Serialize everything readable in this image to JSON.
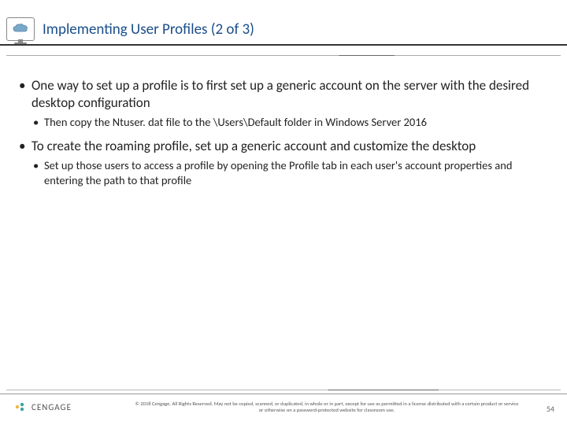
{
  "header": {
    "title": "Implementing User Profiles (2 of 3)",
    "icon": "cloud-monitor-icon"
  },
  "content": {
    "bullets": [
      {
        "text": "One way to set up a profile is to first set up a generic account on the server with the desired desktop configuration",
        "sub": [
          {
            "text": "Then copy the Ntuser. dat file to the \\Users\\Default folder in Windows Server 2016"
          }
        ]
      },
      {
        "text": "To create the roaming profile, set up a generic account and customize the desktop",
        "sub": [
          {
            "text": "Set up those users to access a profile by opening the Profile tab in each user's account properties and entering the path to that profile"
          }
        ]
      }
    ]
  },
  "footer": {
    "logo_text": "CENGAGE",
    "copyright": "© 2018 Cengage. All Rights Reserved. May not be copied, scanned, or duplicated, in whole or in part, except for use as permitted in a license distributed with a certain product or service or otherwise on a password-protected website for classroom use.",
    "page_number": "54"
  }
}
